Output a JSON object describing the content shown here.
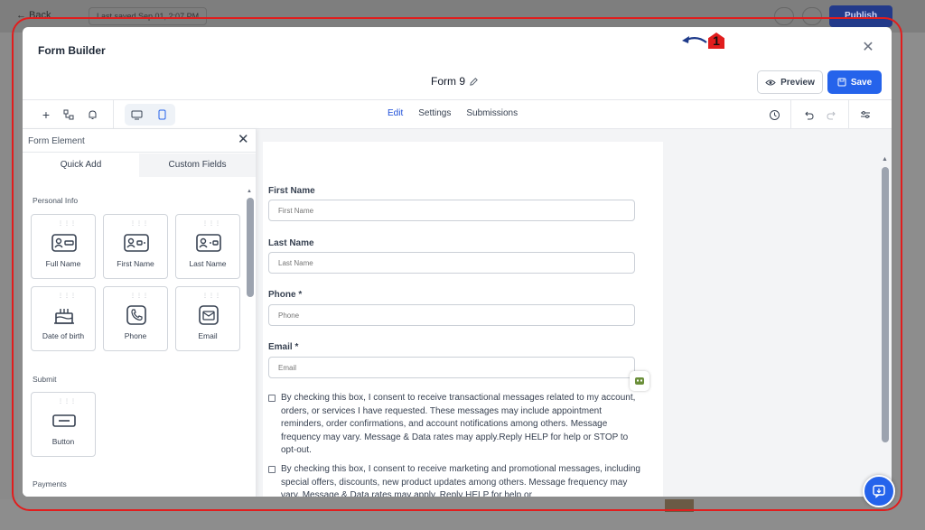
{
  "background": {
    "back_label": "← Back",
    "last_saved": "Last saved Sep 01, 2:07 PM",
    "publish_label": "Publish"
  },
  "modal": {
    "title": "Form Builder",
    "form_name": "Form 9",
    "preview_label": "Preview",
    "save_label": "Save"
  },
  "toolbar": {
    "tabs": [
      "Edit",
      "Settings",
      "Submissions"
    ],
    "active_tab": "Edit"
  },
  "panel": {
    "title": "Form Element",
    "tabs": [
      "Quick Add",
      "Custom Fields"
    ],
    "sections": {
      "personal": "Personal Info",
      "submit": "Submit",
      "payments": "Payments"
    },
    "cards": [
      "Full Name",
      "First Name",
      "Last Name",
      "Date of birth",
      "Phone",
      "Email"
    ],
    "submit_card": "Button"
  },
  "form": {
    "fields": [
      {
        "label": "First Name",
        "placeholder": "First Name"
      },
      {
        "label": "Last Name",
        "placeholder": "Last Name"
      },
      {
        "label": "Phone *",
        "placeholder": "Phone"
      },
      {
        "label": "Email *",
        "placeholder": "Email"
      }
    ],
    "consent_transactional": "By checking this box, I consent to receive transactional messages related to my account, orders, or services I have requested. These messages may include appointment reminders, order confirmations, and account notifications among others. Message frequency may vary. Message & Data rates may apply.Reply HELP for help or STOP to opt-out.",
    "consent_marketing": "By checking this box, I consent to receive marketing and promotional messages, including special offers, discounts, new product updates among others. Message frequency may vary. Message & Data rates may apply. Reply HELP for help or"
  },
  "annotation": {
    "step": "1"
  },
  "colors": {
    "accent": "#2563eb",
    "annotation": "#e11d1d"
  }
}
